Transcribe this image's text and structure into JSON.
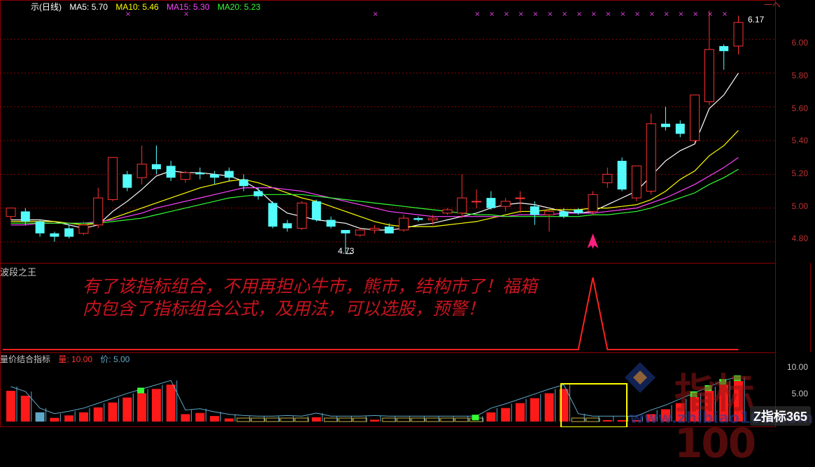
{
  "main_panel": {
    "title_prefix": "示(日线)",
    "legend": [
      {
        "label": "MA5:",
        "value": "5.70",
        "color": "#ffffff"
      },
      {
        "label": "MA10:",
        "value": "5.46",
        "color": "#ffff00"
      },
      {
        "label": "MA15:",
        "value": "5.30",
        "color": "#ff44ff"
      },
      {
        "label": "MA20:",
        "value": "5.23",
        "color": "#33ff33"
      }
    ],
    "y_ticks": [
      "6.00",
      "5.80",
      "5.60",
      "5.40",
      "5.20",
      "5.00",
      "4.80"
    ],
    "high_label": "6.17",
    "low_label": "4.73",
    "top_right_label": "一ヘ",
    "colors": {
      "up": "#ff3232",
      "down": "#54fcfc",
      "grid": "#8b0000",
      "buy_arrow": "#ff1f7f",
      "marker": "#e040e0"
    }
  },
  "middle_panel": {
    "title": "波段之王",
    "overlay_text": "有了该指标组合，不用再担心牛市，熊市，结构市了！福箱内包含了指标组合公式，及用法，可以选股，预警！"
  },
  "bottom_panel": {
    "title": "量价结合指标",
    "legend": [
      {
        "label": "量:",
        "value": "10.00",
        "color": "#ff3232"
      },
      {
        "label": "价:",
        "value": "5.00",
        "color": "#5fa8c8"
      }
    ],
    "y_ticks": [
      "10.00",
      "5.00"
    ]
  },
  "watermarks": {
    "logo": "Z指标365",
    "big": "指标100",
    "url": "www.zhibiao100.com"
  },
  "chart_data": {
    "type": "candlestick",
    "y_range": [
      4.7,
      6.2
    ],
    "candles": [
      [
        4.95,
        5.0,
        4.93,
        4.98
      ],
      [
        4.98,
        4.92,
        4.9,
        5.0
      ],
      [
        4.92,
        4.85,
        4.83,
        4.93
      ],
      [
        4.85,
        4.83,
        4.8,
        4.86
      ],
      [
        4.88,
        4.83,
        4.82,
        4.9
      ],
      [
        4.85,
        4.9,
        4.84,
        4.92
      ],
      [
        4.9,
        5.06,
        4.88,
        5.12
      ],
      [
        5.05,
        5.3,
        5.04,
        5.3
      ],
      [
        5.2,
        5.12,
        5.1,
        5.22
      ],
      [
        5.18,
        5.26,
        5.14,
        5.37
      ],
      [
        5.26,
        5.23,
        5.2,
        5.37
      ],
      [
        5.25,
        5.18,
        5.16,
        5.28
      ],
      [
        5.17,
        5.21,
        5.15,
        5.22
      ],
      [
        5.21,
        5.2,
        5.17,
        5.24
      ],
      [
        5.2,
        5.18,
        5.14,
        5.22
      ],
      [
        5.22,
        5.18,
        5.16,
        5.24
      ],
      [
        5.17,
        5.13,
        5.1,
        5.2
      ],
      [
        5.1,
        5.07,
        5.05,
        5.12
      ],
      [
        5.03,
        4.89,
        4.88,
        5.04
      ],
      [
        4.91,
        4.88,
        4.86,
        4.93
      ],
      [
        4.88,
        5.03,
        4.87,
        5.04
      ],
      [
        5.04,
        4.93,
        4.92,
        5.05
      ],
      [
        4.93,
        4.89,
        4.88,
        4.95
      ],
      [
        4.87,
        4.85,
        4.73,
        4.87
      ],
      [
        4.84,
        4.87,
        4.83,
        4.88
      ],
      [
        4.87,
        4.88,
        4.85,
        4.9
      ],
      [
        4.89,
        4.85,
        4.85,
        4.91
      ],
      [
        4.87,
        4.94,
        4.86,
        4.96
      ],
      [
        4.94,
        4.93,
        4.92,
        4.95
      ],
      [
        4.93,
        4.94,
        4.9,
        4.96
      ],
      [
        4.97,
        4.99,
        4.96,
        5.0
      ],
      [
        4.97,
        5.06,
        4.94,
        5.2
      ],
      [
        5.04,
        5.04,
        5.0,
        5.11
      ],
      [
        5.06,
        5.0,
        4.99,
        5.1
      ],
      [
        5.01,
        5.04,
        4.98,
        5.06
      ],
      [
        5.06,
        5.06,
        4.97,
        5.1
      ],
      [
        5.01,
        4.96,
        4.9,
        5.04
      ],
      [
        4.96,
        4.98,
        4.86,
        4.99
      ],
      [
        4.98,
        4.95,
        4.94,
        5.0
      ],
      [
        4.99,
        4.97,
        4.96,
        5.0
      ],
      [
        4.98,
        5.08,
        4.96,
        5.1
      ],
      [
        5.15,
        5.2,
        5.12,
        5.24
      ],
      [
        5.28,
        5.11,
        5.1,
        5.3
      ],
      [
        5.06,
        5.25,
        5.04,
        5.25
      ],
      [
        5.1,
        5.5,
        5.08,
        5.56
      ],
      [
        5.5,
        5.48,
        5.46,
        5.6
      ],
      [
        5.5,
        5.44,
        5.42,
        5.52
      ],
      [
        5.4,
        5.67,
        5.39,
        5.67
      ],
      [
        5.63,
        5.94,
        5.61,
        6.17
      ],
      [
        5.96,
        5.93,
        5.82,
        5.97
      ],
      [
        5.96,
        6.1,
        5.91,
        6.14
      ]
    ],
    "ma_series": [
      {
        "name": "MA5",
        "color": "#ffffff",
        "values": [
          4.93,
          4.93,
          4.93,
          4.92,
          4.9,
          4.88,
          4.9,
          4.98,
          5.04,
          5.11,
          5.19,
          5.22,
          5.21,
          5.21,
          5.2,
          5.19,
          5.16,
          5.11,
          5.03,
          4.97,
          4.95,
          4.93,
          4.92,
          4.91,
          4.88,
          4.87,
          4.87,
          4.88,
          4.9,
          4.91,
          4.93,
          4.95,
          4.97,
          5.0,
          5.02,
          5.03,
          5.02,
          5.0,
          4.98,
          4.97,
          4.98,
          5.02,
          5.06,
          5.1,
          5.19,
          5.28,
          5.34,
          5.38,
          5.59,
          5.67,
          5.8
        ]
      },
      {
        "name": "MA10",
        "color": "#ffff00",
        "values": [
          4.92,
          4.92,
          4.92,
          4.92,
          4.91,
          4.9,
          4.91,
          4.94,
          4.97,
          5.0,
          5.03,
          5.06,
          5.09,
          5.12,
          5.14,
          5.16,
          5.17,
          5.15,
          5.12,
          5.09,
          5.06,
          5.04,
          5.01,
          4.98,
          4.95,
          4.92,
          4.9,
          4.89,
          4.89,
          4.89,
          4.9,
          4.91,
          4.92,
          4.94,
          4.96,
          4.98,
          4.98,
          4.99,
          4.99,
          4.99,
          5.0,
          5.0,
          5.01,
          5.02,
          5.05,
          5.1,
          5.17,
          5.22,
          5.31,
          5.37,
          5.46
        ]
      },
      {
        "name": "MA15",
        "color": "#ff44ff",
        "values": [
          4.9,
          4.9,
          4.91,
          4.91,
          4.91,
          4.91,
          4.92,
          4.93,
          4.95,
          4.97,
          5.0,
          5.02,
          5.04,
          5.06,
          5.08,
          5.1,
          5.12,
          5.12,
          5.12,
          5.11,
          5.1,
          5.08,
          5.06,
          5.04,
          5.02,
          5.0,
          4.98,
          4.97,
          4.96,
          4.95,
          4.95,
          4.95,
          4.95,
          4.95,
          4.95,
          4.96,
          4.96,
          4.96,
          4.97,
          4.97,
          4.97,
          4.98,
          4.99,
          5.0,
          5.03,
          5.06,
          5.1,
          5.14,
          5.19,
          5.24,
          5.3
        ]
      },
      {
        "name": "MA20",
        "color": "#33ff33",
        "values": [
          4.91,
          4.91,
          4.91,
          4.91,
          4.91,
          4.91,
          4.91,
          4.92,
          4.93,
          4.94,
          4.96,
          4.98,
          5.0,
          5.02,
          5.04,
          5.06,
          5.07,
          5.08,
          5.08,
          5.08,
          5.08,
          5.07,
          5.06,
          5.05,
          5.04,
          5.03,
          5.02,
          5.01,
          5.0,
          4.99,
          4.98,
          4.97,
          4.96,
          4.96,
          4.95,
          4.95,
          4.95,
          4.95,
          4.95,
          4.95,
          4.96,
          4.96,
          4.97,
          4.98,
          5.0,
          5.03,
          5.06,
          5.09,
          5.14,
          5.18,
          5.23
        ]
      }
    ],
    "signal_series": [
      0,
      0,
      0,
      0,
      0,
      0,
      0,
      0,
      0,
      0,
      0,
      0,
      0,
      0,
      0,
      0,
      0,
      0,
      0,
      0,
      0,
      0,
      0,
      0,
      0,
      0,
      0,
      0,
      0,
      0,
      0,
      0,
      0,
      0,
      0,
      0,
      0,
      0,
      0,
      0,
      1,
      0,
      0,
      0,
      0,
      0,
      0,
      0,
      0,
      0,
      0
    ],
    "volume_bars": [
      5.0,
      4.2,
      1.5,
      0.6,
      1.0,
      1.5,
      2.3,
      3.1,
      3.9,
      4.6,
      5.3,
      6.0,
      1.2,
      1.4,
      0.9,
      0.5,
      0.3,
      0.2,
      0.2,
      0.3,
      0.2,
      0.7,
      0.2,
      0.2,
      0.2,
      0.3,
      0.2,
      0.2,
      0.2,
      0.2,
      0.2,
      0.2,
      0.2,
      1.5,
      2.2,
      3.0,
      3.8,
      4.6,
      5.3,
      0.6,
      0.2,
      0.2,
      0.2,
      0.2,
      1.2,
      2.0,
      3.0,
      4.0,
      5.0,
      6.0,
      6.6
    ],
    "volume_colors": [
      "red",
      "red",
      "cyan",
      "red",
      "red",
      "red",
      "red",
      "red",
      "red",
      "red",
      "red",
      "red",
      "red",
      "red",
      "red",
      "red",
      "yellow",
      "yellow",
      "yellow",
      "yellow",
      "yellow",
      "red",
      "yellow",
      "yellow",
      "yellow",
      "red",
      "yellow",
      "yellow",
      "yellow",
      "yellow",
      "yellow",
      "yellow",
      "yellow",
      "red",
      "red",
      "red",
      "red",
      "red",
      "red",
      "yellow",
      "yellow",
      "red",
      "red",
      "red",
      "red",
      "red",
      "red",
      "red",
      "red",
      "red",
      "red"
    ]
  }
}
